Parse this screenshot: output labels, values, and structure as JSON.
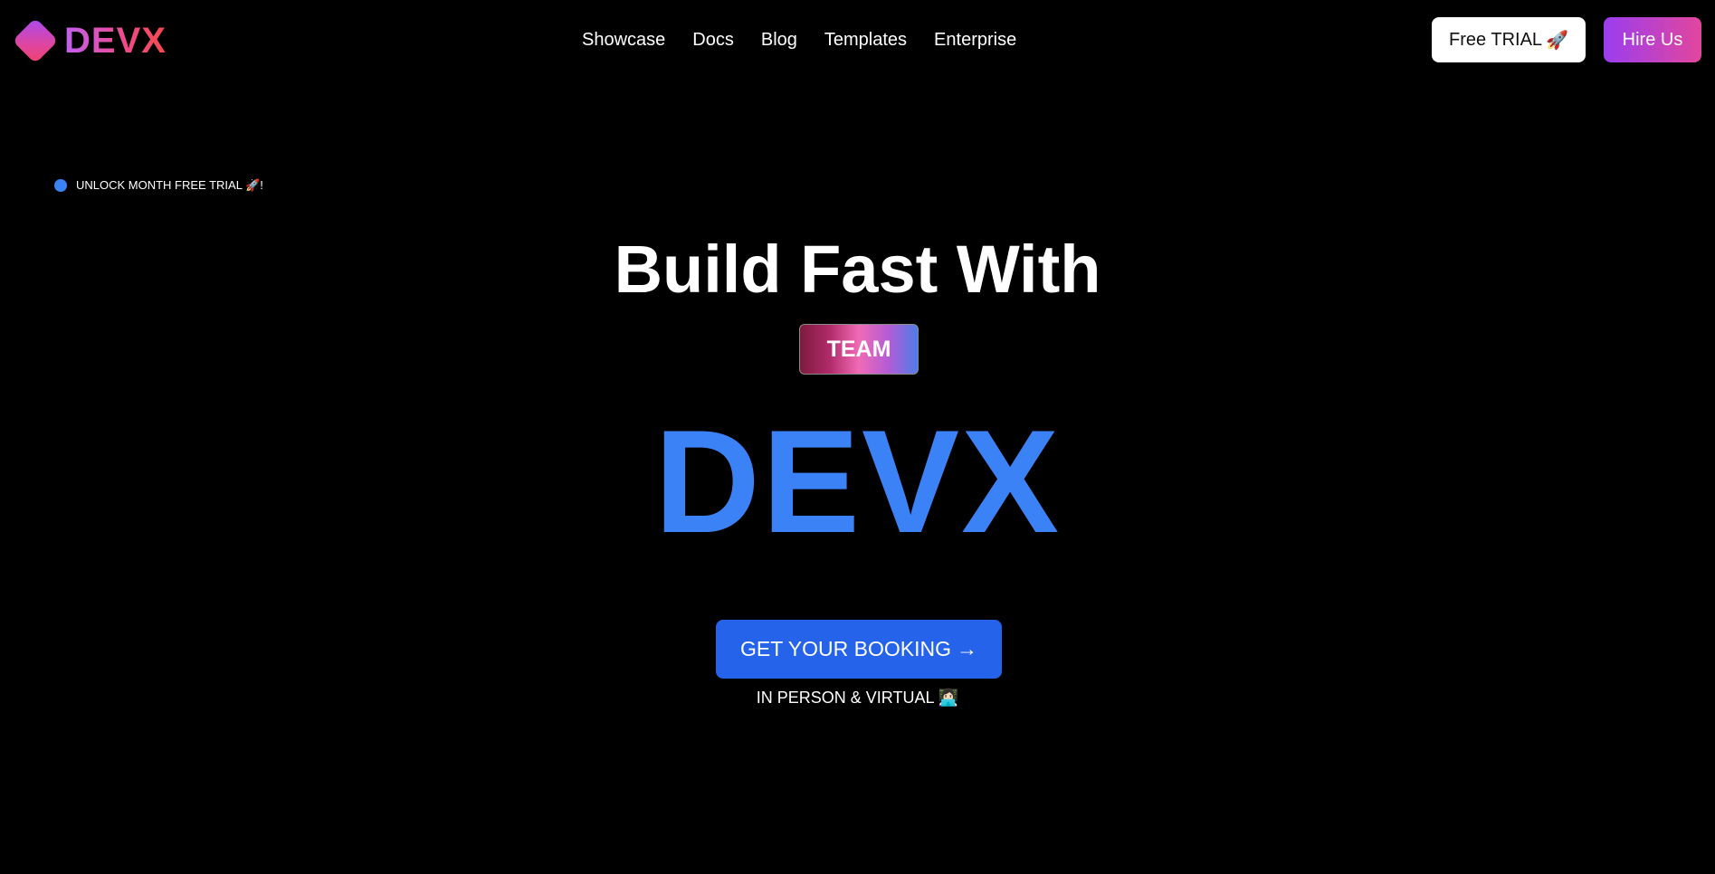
{
  "brand": {
    "name": "DEVX"
  },
  "nav": {
    "items": [
      {
        "label": "Showcase"
      },
      {
        "label": "Docs"
      },
      {
        "label": "Blog"
      },
      {
        "label": "Templates"
      },
      {
        "label": "Enterprise"
      }
    ]
  },
  "header_actions": {
    "trial_label": "Free TRIAL",
    "trial_icon": "🚀",
    "hire_label": "Hire Us"
  },
  "announcement": {
    "text": "UNLOCK MONTH FREE TRIAL 🚀!",
    "dot_color": "#3b82f6"
  },
  "hero": {
    "headline": "Build Fast With",
    "badge": "TEAM",
    "brand_word": "DEVX",
    "brand_color": "#3b82f6",
    "cta_label": "GET YOUR BOOKING",
    "cta_arrow": "→",
    "subline": "IN PERSON & VIRTUAL 👩🏻‍💻"
  },
  "colors": {
    "background": "#000000",
    "cta": "#2563eb",
    "accent_purple": "#9b3df0",
    "accent_pink": "#e2469c"
  }
}
